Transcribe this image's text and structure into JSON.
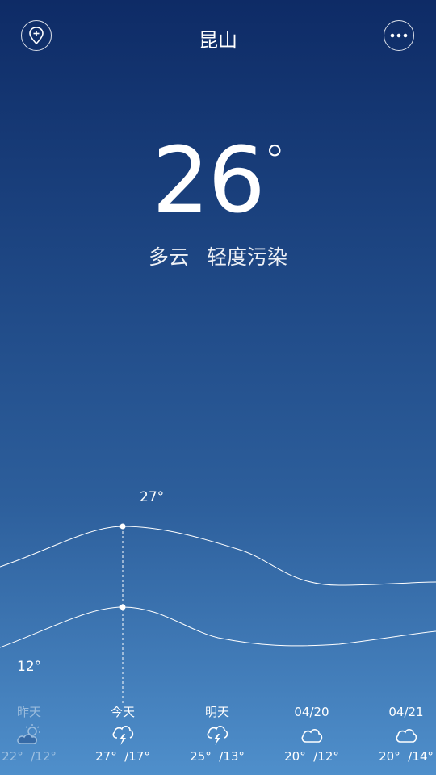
{
  "app": {
    "city": "昆山",
    "current_temp": "26",
    "degree": "°",
    "condition": "多云",
    "air_quality": "轻度污染"
  },
  "chart": {
    "high_label": "27°",
    "low_label": "12°"
  },
  "chart_data": {
    "type": "line",
    "categories": [
      "昨天",
      "今天",
      "明天",
      "04/20",
      "04/21"
    ],
    "series": [
      {
        "values": [
          22,
          27,
          25,
          20,
          20
        ]
      },
      {
        "values": [
          12,
          17,
          13,
          12,
          14
        ]
      }
    ]
  },
  "forecast": [
    {
      "label": "昨天",
      "high": "22°",
      "low": "/12°",
      "icon": "partly-sunny-icon",
      "past": true
    },
    {
      "label": "今天",
      "high": "27°",
      "low": "/17°",
      "icon": "thunderstorm-icon",
      "past": false
    },
    {
      "label": "明天",
      "high": "25°",
      "low": "/13°",
      "icon": "thunderstorm-icon",
      "past": false
    },
    {
      "label": "04/20",
      "high": "20°",
      "low": "/12°",
      "icon": "cloudy-icon",
      "past": false
    },
    {
      "label": "04/21",
      "high": "20°",
      "low": "/14°",
      "icon": "cloudy-icon",
      "past": false
    }
  ],
  "colors": {
    "bg_top": "#0e2b66",
    "bg_bottom": "#4f8fcb",
    "line": "#ffffff"
  }
}
